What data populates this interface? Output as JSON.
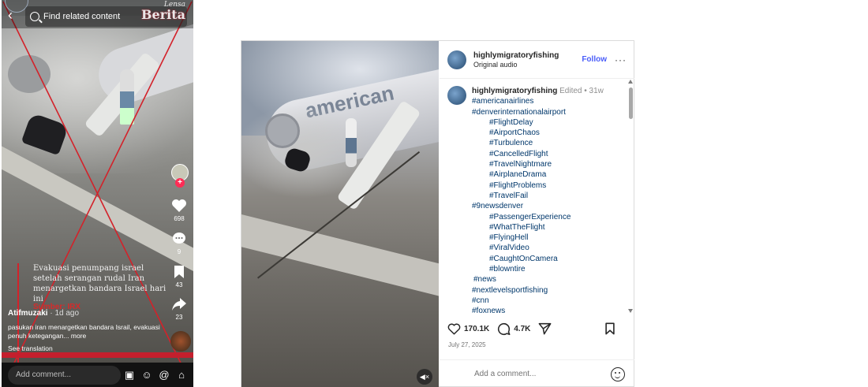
{
  "tiktok": {
    "search_placeholder": "Find related content",
    "watermark_top": "Lensa",
    "watermark_bottom": "Berita",
    "caption": "Evakuasi penumpang israel setelah serangan rudal Iran menargetkan bandara Israel hari ini",
    "source": "Sumber: IRX",
    "likes": "698",
    "comments": "9",
    "saves": "43",
    "shares": "23",
    "username": "Atifmuzaki",
    "posted_ago": "· 1d ago",
    "description": "pasukan iran menargetkan bandara Israil, evakuasi penuh ketegangan...",
    "more_label": "more",
    "see_translation": "See translation",
    "comment_placeholder": "Add comment...",
    "icons": [
      "back-icon",
      "search-icon",
      "heart-icon",
      "comment-icon",
      "bookmark-icon",
      "share-icon",
      "image-icon",
      "emoji-icon",
      "mention-icon",
      "gift-icon"
    ]
  },
  "instagram": {
    "username": "highlymigratoryfishing",
    "audio": "Original audio",
    "follow_label": "Follow",
    "more_label": "···",
    "caption_user": "highlymigratoryfishing",
    "caption_meta": "Edited • 31w",
    "hashtags": [
      {
        "text": "#americanairlines",
        "level": 0
      },
      {
        "text": "#denverinternationalairport",
        "level": 0
      },
      {
        "text": "#FlightDelay",
        "level": 1
      },
      {
        "text": "#AirportChaos",
        "level": 1
      },
      {
        "text": "#Turbulence",
        "level": 1
      },
      {
        "text": "#CancelledFlight",
        "level": 1
      },
      {
        "text": "#TravelNightmare",
        "level": 1
      },
      {
        "text": "#AirplaneDrama",
        "level": 1
      },
      {
        "text": "#FlightProblems",
        "level": 1
      },
      {
        "text": "#TravelFail",
        "level": 1
      },
      {
        "text": "#9newsdenver",
        "level": 0
      },
      {
        "text": "#PassengerExperience",
        "level": 1
      },
      {
        "text": "#WhatTheFlight",
        "level": 1
      },
      {
        "text": "#FlyingHell",
        "level": 1
      },
      {
        "text": "#ViralVideo",
        "level": 1
      },
      {
        "text": "#CaughtOnCamera",
        "level": 1
      },
      {
        "text": "#blowntire",
        "level": 1
      },
      {
        "text": "#news",
        "level": 2
      },
      {
        "text": "#nextlevelsportfishing",
        "level": 0
      },
      {
        "text": "#cnn",
        "level": 0
      },
      {
        "text": "#foxnews",
        "level": 0
      }
    ],
    "likes": "170.1K",
    "comments": "4.7K",
    "date": "July 27, 2025",
    "comment_placeholder": "Add a comment...",
    "media_brand": "american",
    "accent_color": "#4a5df9"
  }
}
